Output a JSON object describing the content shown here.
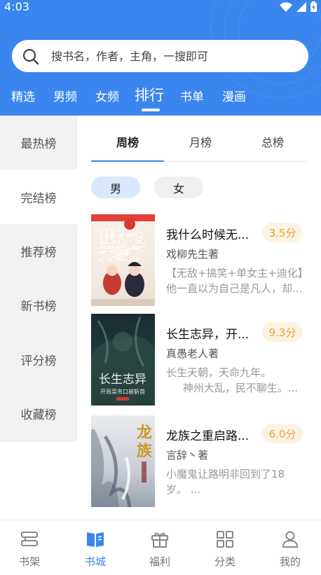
{
  "status_bar": {
    "time": "4:03"
  },
  "search": {
    "placeholder": "搜书名，作者，主角，一搜即可"
  },
  "tabs": [
    {
      "label": "精选"
    },
    {
      "label": "男频"
    },
    {
      "label": "女频"
    },
    {
      "label": "排行",
      "active": true
    },
    {
      "label": "书单"
    },
    {
      "label": "漫画"
    }
  ],
  "sidebar": {
    "items": [
      {
        "label": "最热榜"
      },
      {
        "label": "完结榜",
        "active": true
      },
      {
        "label": "推荐榜"
      },
      {
        "label": "新书榜"
      },
      {
        "label": "评分榜"
      },
      {
        "label": "收藏榜"
      }
    ]
  },
  "period_tabs": [
    {
      "label": "周榜",
      "active": true
    },
    {
      "label": "月榜"
    },
    {
      "label": "总榜"
    }
  ],
  "gender_filter": [
    {
      "label": "男",
      "active": true
    },
    {
      "label": "女"
    }
  ],
  "books": [
    {
      "title": "我什么时候无...",
      "score": "3.5分",
      "author": "戏柳先生著",
      "desc": "【无敌+搞笑+单女主+迪化】他一直以为自己是凡人，却...",
      "cover_text": "我什么时候无敌了"
    },
    {
      "title": "长生志异，开...",
      "score": "9.3分",
      "author": "真愚老人著",
      "desc": "长生天朝，天命九年。\n     神州大乱，民不聊生。...",
      "cover_text": "长生志异",
      "cover_subtext": "开局菜市口被斩首"
    },
    {
      "title": "龙族之重启路...",
      "score": "6.0分",
      "author": "言辞丶著",
      "desc": "小魔鬼让路明非回到了18岁。 ...",
      "cover_text": "龙族"
    }
  ],
  "bottom_nav": [
    {
      "label": "书架",
      "icon": "bookshelf-icon"
    },
    {
      "label": "书城",
      "icon": "bookstore-icon",
      "active": true
    },
    {
      "label": "福利",
      "icon": "gift-icon"
    },
    {
      "label": "分类",
      "icon": "category-icon"
    },
    {
      "label": "我的",
      "icon": "profile-icon"
    }
  ],
  "colors": {
    "accent": "#3b86ee",
    "score_text": "#e9a23b",
    "score_bg": "#fdf3e2"
  }
}
